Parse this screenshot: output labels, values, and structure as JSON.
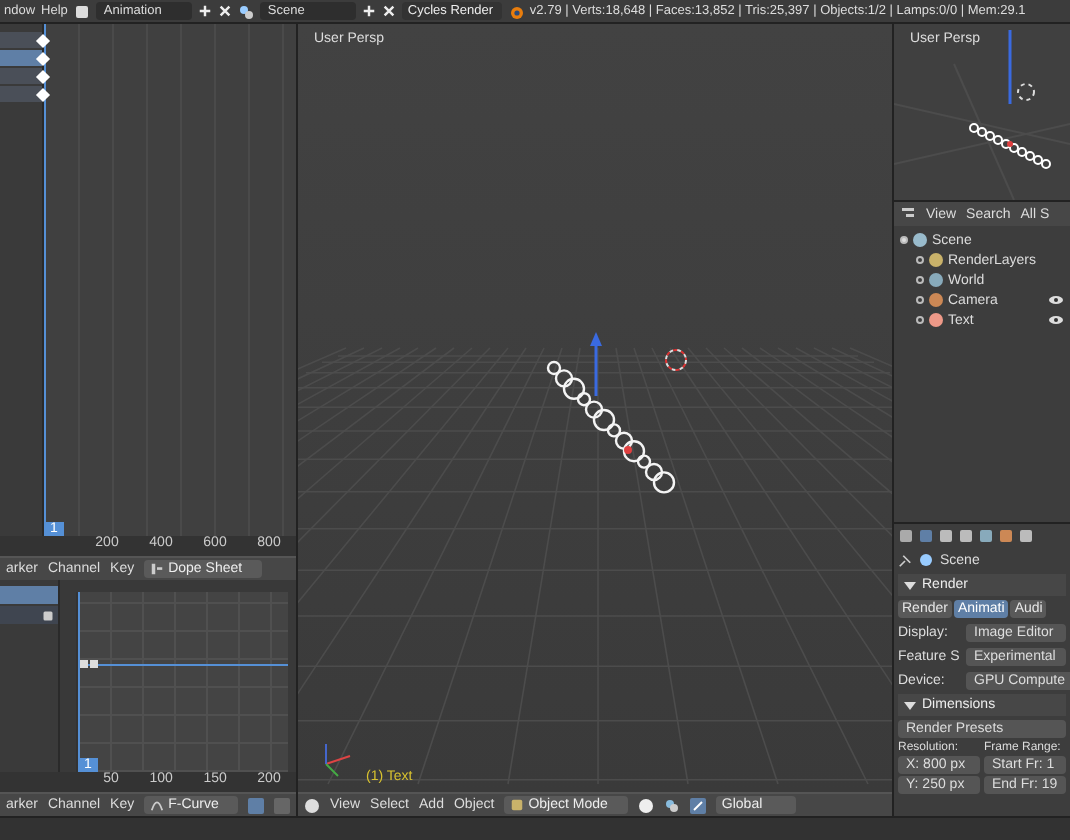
{
  "top_bar": {
    "menus": [
      "ndow",
      "Help"
    ],
    "screen_layout": "Animation",
    "scene": "Scene",
    "render_engine": "Cycles Render",
    "stats": "v2.79 | Verts:18,648 | Faces:13,852 | Tris:25,397 | Objects:1/2 | Lamps:0/0 | Mem:29.1"
  },
  "dope_sheet": {
    "channels": [
      {
        "selected": false
      },
      {
        "selected": true
      },
      {
        "selected": false
      },
      {
        "selected": false
      }
    ],
    "ruler": [
      "200",
      "400",
      "600",
      "800"
    ],
    "current_frame": "1",
    "header": {
      "menus": [
        "arker",
        "Channel",
        "Key"
      ],
      "mode": "Dope Sheet"
    }
  },
  "graph_editor": {
    "ruler": [
      "50",
      "100",
      "150",
      "200"
    ],
    "current_frame": "1",
    "header": {
      "menus": [
        "arker",
        "Channel",
        "Key"
      ],
      "mode": "F-Curve"
    }
  },
  "viewport": {
    "label": "User Persp",
    "object_label": "(1) Text",
    "header": {
      "menus": [
        "View",
        "Select",
        "Add",
        "Object"
      ],
      "mode": "Object Mode",
      "orientation": "Global"
    }
  },
  "mini_viewport": {
    "label": "User Persp"
  },
  "outliner": {
    "menus": [
      "View",
      "Search",
      "All S"
    ],
    "tree": [
      {
        "label": "Scene",
        "expanded": true,
        "visible": false,
        "children": [
          {
            "label": "RenderLayers",
            "expanded": false,
            "visible": false
          },
          {
            "label": "World",
            "expanded": false,
            "visible": false
          },
          {
            "label": "Camera",
            "expanded": false,
            "visible": true
          },
          {
            "label": "Text",
            "expanded": false,
            "visible": true
          }
        ]
      }
    ]
  },
  "properties": {
    "context": "Scene",
    "panels": [
      {
        "title": "Render",
        "expanded": true,
        "buttons": [
          {
            "label": "Render",
            "selected": false
          },
          {
            "label": "Animati",
            "selected": true
          },
          {
            "label": "Audi",
            "selected": false
          }
        ],
        "fields": [
          {
            "label": "Display:",
            "value": "Image Editor"
          },
          {
            "label": "Feature S",
            "value": "Experimental"
          },
          {
            "label": "Device:",
            "value": "GPU Compute"
          }
        ]
      },
      {
        "title": "Dimensions",
        "expanded": true,
        "presets": "Render Presets",
        "columns": [
          {
            "heading": "Resolution:",
            "fields": [
              "X: 800 px",
              "Y: 250 px"
            ]
          },
          {
            "heading": "Frame Range:",
            "fields": [
              "Start Fr: 1",
              "End Fr: 19"
            ]
          }
        ]
      }
    ]
  }
}
